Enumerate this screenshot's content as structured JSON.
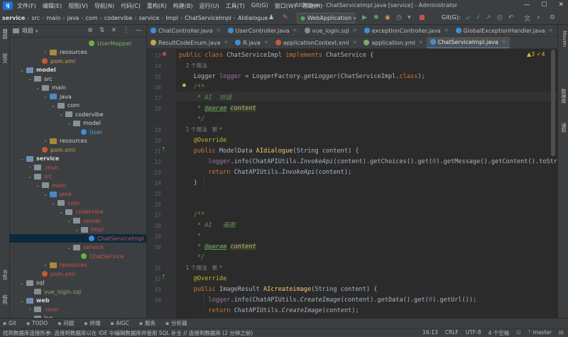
{
  "menubar": {
    "logo": "IJ",
    "items": [
      "文件(F)",
      "编辑(E)",
      "视图(V)",
      "导航(N)",
      "代码(C)",
      "重构(R)",
      "构建(B)",
      "运行(U)",
      "工具(T)",
      "Git(G)",
      "窗口(W)",
      "帮助(H)"
    ],
    "window_title": "AIGideon - ChatServiceImpl.java [service] - Administrator"
  },
  "navbar": {
    "breadcrumbs": [
      "service",
      "src",
      "main",
      "java",
      "com",
      "codervibe",
      "service",
      "Impl",
      "ChatServiceImpl",
      "AIdialogue"
    ],
    "run_config": "WebApplication",
    "git_label": "Git(G):"
  },
  "left_strip": {
    "labels": [
      "项目",
      "提交",
      "书签",
      "结构"
    ]
  },
  "right_strip": {
    "labels": [
      "Maven",
      "数据库",
      "通知"
    ]
  },
  "project_panel": {
    "title": "项目",
    "tree": [
      {
        "label": "UserMapper",
        "indent": 9,
        "arrow": "",
        "icon": "intf",
        "color": "tl-green"
      },
      {
        "label": "resources",
        "indent": 4,
        "arrow": "›",
        "icon": "res",
        "color": "tl-white"
      },
      {
        "label": "pom.xml",
        "indent": 3,
        "arrow": "",
        "icon": "pom",
        "color": "tl-orange"
      },
      {
        "label": "model",
        "indent": 1,
        "arrow": "⌄",
        "icon": "mod",
        "color": "tl-bold"
      },
      {
        "label": "src",
        "indent": 2,
        "arrow": "⌄",
        "icon": "folder",
        "color": "tl-white"
      },
      {
        "label": "main",
        "indent": 3,
        "arrow": "⌄",
        "icon": "folder",
        "color": "tl-white"
      },
      {
        "label": "java",
        "indent": 4,
        "arrow": "⌄",
        "icon": "blue",
        "color": "tl-white"
      },
      {
        "label": "com",
        "indent": 5,
        "arrow": "⌄",
        "icon": "folder",
        "color": "tl-white"
      },
      {
        "label": "codervibe",
        "indent": 6,
        "arrow": "⌄",
        "icon": "folder",
        "color": "tl-white"
      },
      {
        "label": "model",
        "indent": 7,
        "arrow": "⌄",
        "icon": "folder",
        "color": "tl-white"
      },
      {
        "label": "User",
        "indent": 8,
        "arrow": "",
        "icon": "cls",
        "color": "tl-blue"
      },
      {
        "label": "resources",
        "indent": 4,
        "arrow": "›",
        "icon": "res",
        "color": "tl-white"
      },
      {
        "label": "pom.xml",
        "indent": 3,
        "arrow": "",
        "icon": "pom",
        "color": "tl-orange"
      },
      {
        "label": "service",
        "indent": 1,
        "arrow": "⌄",
        "icon": "mod",
        "color": "tl-bold"
      },
      {
        "label": ".mvn",
        "indent": 2,
        "arrow": "›",
        "icon": "folder",
        "color": "tl-red"
      },
      {
        "label": "src",
        "indent": 2,
        "arrow": "⌄",
        "icon": "folder",
        "color": "tl-red"
      },
      {
        "label": "main",
        "indent": 3,
        "arrow": "⌄",
        "icon": "folder",
        "color": "tl-red"
      },
      {
        "label": "java",
        "indent": 4,
        "arrow": "⌄",
        "icon": "blue",
        "color": "tl-red"
      },
      {
        "label": "com",
        "indent": 5,
        "arrow": "⌄",
        "icon": "folder",
        "color": "tl-red"
      },
      {
        "label": "codervibe",
        "indent": 6,
        "arrow": "⌄",
        "icon": "folder",
        "color": "tl-red"
      },
      {
        "label": "server",
        "indent": 7,
        "arrow": "⌄",
        "icon": "folder",
        "color": "tl-red"
      },
      {
        "label": "Impl",
        "indent": 8,
        "arrow": "⌄",
        "icon": "folder",
        "color": "tl-red"
      },
      {
        "label": "ChatServiceImpl",
        "indent": 9,
        "arrow": "",
        "icon": "cls",
        "color": "tl-red",
        "selected": true
      },
      {
        "label": "service",
        "indent": 7,
        "arrow": "⌄",
        "icon": "folder",
        "color": "tl-red"
      },
      {
        "label": "ChatService",
        "indent": 8,
        "arrow": "",
        "icon": "intf",
        "color": "tl-red"
      },
      {
        "label": "resources",
        "indent": 4,
        "arrow": "›",
        "icon": "res",
        "color": "tl-red"
      },
      {
        "label": "pom.xml",
        "indent": 3,
        "arrow": "",
        "icon": "pom",
        "color": "tl-red"
      },
      {
        "label": "sql",
        "indent": 1,
        "arrow": "⌄",
        "icon": "folder",
        "color": "tl-white"
      },
      {
        "label": "vue_login.sql",
        "indent": 2,
        "arrow": "",
        "icon": "sql",
        "color": "tl-olive"
      },
      {
        "label": "web",
        "indent": 1,
        "arrow": "⌄",
        "icon": "mod",
        "color": "tl-bold"
      },
      {
        "label": ".mvn",
        "indent": 2,
        "arrow": "›",
        "icon": "folder",
        "color": "tl-red"
      },
      {
        "label": "log",
        "indent": 2,
        "arrow": "›",
        "icon": "folder",
        "color": "tl-white"
      }
    ]
  },
  "tabs_row1": [
    {
      "label": "ChatController.java",
      "color": "#3f8fd6",
      "active": false
    },
    {
      "label": "UserController.java",
      "color": "#3f8fd6",
      "active": false
    },
    {
      "label": "vue_login.sql",
      "color": "#8a8a8a",
      "active": false
    },
    {
      "label": "exceptionController.java",
      "color": "#3f8fd6",
      "active": false
    },
    {
      "label": "GlobalExceptionHandler.java",
      "color": "#3f8fd6",
      "active": false
    }
  ],
  "tabs_row2": [
    {
      "label": "ResultCodeEnum.java",
      "color": "#c9a24c",
      "active": false
    },
    {
      "label": "R.java",
      "color": "#3f8fd6",
      "active": false
    },
    {
      "label": "applicationContext.xml",
      "color": "#c45a3a",
      "active": false
    },
    {
      "label": "application.yml",
      "color": "#7fae5a",
      "active": false
    },
    {
      "label": "ChatServiceImpl.java",
      "color": "#3f8fd6",
      "active": true
    }
  ],
  "editor": {
    "inspection": "▲3  ✓4",
    "line_numbers": [
      "13",
      "14",
      "15",
      "16",
      "17",
      "18",
      "",
      "19",
      "20",
      "21",
      "22",
      "23",
      "24",
      "25",
      "26",
      "27",
      "28",
      "29",
      "30",
      "",
      "31",
      "32",
      "33",
      "34"
    ],
    "lines": [
      [
        {
          "t": "public class ",
          "c": "kw"
        },
        {
          "t": "ChatServiceImpl ",
          "c": ""
        },
        {
          "t": "implements ",
          "c": "kw"
        },
        {
          "t": "ChatService {",
          "c": ""
        }
      ],
      [
        {
          "t": "    2 个用法",
          "c": "hint"
        }
      ],
      [
        {
          "t": "    Logger ",
          "c": ""
        },
        {
          "t": "logger",
          "c": "fld"
        },
        {
          "t": " = LoggerFactory.",
          "c": ""
        },
        {
          "t": "getLogger",
          "c": "stat"
        },
        {
          "t": "(ChatServiceImpl.",
          "c": ""
        },
        {
          "t": "class",
          "c": "kw"
        },
        {
          "t": ");",
          "c": ""
        }
      ],
      [
        {
          "t": "    /**",
          "c": "cmt"
        }
      ],
      [
        {
          "t": "     * AI  对话",
          "c": "cmt"
        }
      ],
      [
        {
          "t": "     * ",
          "c": "cmt"
        },
        {
          "t": "@param",
          "c": "tag"
        },
        {
          "t": " ",
          "c": "cmt"
        },
        {
          "t": "content",
          "c": "pv"
        }
      ],
      [
        {
          "t": "     */",
          "c": "cmt"
        }
      ],
      [
        {
          "t": "    1 个用法   新 *",
          "c": "hint"
        }
      ],
      [
        {
          "t": "    ",
          "c": ""
        },
        {
          "t": "@Override",
          "c": "ann"
        }
      ],
      [
        {
          "t": "    ",
          "c": ""
        },
        {
          "t": "public ",
          "c": "kw"
        },
        {
          "t": "ModelData ",
          "c": ""
        },
        {
          "t": "AIdialogue",
          "c": "fn"
        },
        {
          "t": "(String content) {",
          "c": ""
        }
      ],
      [
        {
          "t": "        ",
          "c": ""
        },
        {
          "t": "logger",
          "c": "fld"
        },
        {
          "t": ".info(ChatAPIUtils.",
          "c": ""
        },
        {
          "t": "InvokeApi",
          "c": "stat"
        },
        {
          "t": "(content).getChoices().get(",
          "c": ""
        },
        {
          "t": "0",
          "c": "fld"
        },
        {
          "t": ").getMessage().getContent().toString());",
          "c": ""
        }
      ],
      [
        {
          "t": "        ",
          "c": ""
        },
        {
          "t": "return ",
          "c": "kw"
        },
        {
          "t": "ChatAPIUtils.",
          "c": ""
        },
        {
          "t": "InvokeApi",
          "c": "stat"
        },
        {
          "t": "(content);",
          "c": ""
        }
      ],
      [
        {
          "t": "    }",
          "c": ""
        }
      ],
      [
        {
          "t": "",
          "c": ""
        }
      ],
      [
        {
          "t": "",
          "c": ""
        }
      ],
      [
        {
          "t": "    /**",
          "c": "cmt"
        }
      ],
      [
        {
          "t": "     * AI   画图",
          "c": "cmt"
        }
      ],
      [
        {
          "t": "     *",
          "c": "cmt"
        }
      ],
      [
        {
          "t": "     * ",
          "c": "cmt"
        },
        {
          "t": "@param",
          "c": "tag"
        },
        {
          "t": " ",
          "c": "cmt"
        },
        {
          "t": "content",
          "c": "pv"
        }
      ],
      [
        {
          "t": "     */",
          "c": "cmt"
        }
      ],
      [
        {
          "t": "    1 个用法   新 *",
          "c": "hint"
        }
      ],
      [
        {
          "t": "    ",
          "c": ""
        },
        {
          "t": "@Override",
          "c": "ann"
        }
      ],
      [
        {
          "t": "    ",
          "c": ""
        },
        {
          "t": "public ",
          "c": "kw"
        },
        {
          "t": "ImageResult ",
          "c": ""
        },
        {
          "t": "AIcreateimage",
          "c": "fn"
        },
        {
          "t": "(String content) {",
          "c": ""
        }
      ],
      [
        {
          "t": "        ",
          "c": ""
        },
        {
          "t": "logger",
          "c": "fld"
        },
        {
          "t": ".info(ChatAPIUtils.",
          "c": ""
        },
        {
          "t": "CreateImage",
          "c": "stat"
        },
        {
          "t": "(content).getData().get(",
          "c": ""
        },
        {
          "t": "0",
          "c": "fld"
        },
        {
          "t": ").getUrl());",
          "c": ""
        }
      ],
      [
        {
          "t": "        ",
          "c": ""
        },
        {
          "t": "return ",
          "c": "kw"
        },
        {
          "t": "ChatAPIUtils.",
          "c": ""
        },
        {
          "t": "CreateImage",
          "c": "stat"
        },
        {
          "t": "(content);",
          "c": ""
        }
      ],
      [
        {
          "t": "    }",
          "c": ""
        }
      ]
    ]
  },
  "bottombar": {
    "items": [
      {
        "label": "Git",
        "icon": "git-icon"
      },
      {
        "label": "TODO",
        "icon": "todo-icon"
      },
      {
        "label": "问题",
        "icon": "problems-icon"
      },
      {
        "label": "终端",
        "icon": "terminal-icon"
      },
      {
        "label": "AIGC",
        "icon": "aigc-icon"
      },
      {
        "label": "服务",
        "icon": "services-icon"
      },
      {
        "label": "分析器",
        "icon": "profiler-icon"
      }
    ]
  },
  "statusbar": {
    "message": "找到数据库连接形参: 连接到数据库以在 IDE 中编辑数据库并使用 SQL 补全 // 连接到数据库 (2 分钟之前)",
    "position": "16:13",
    "line_sep": "CRLF",
    "encoding": "UTF-8",
    "indent": "4 个空格",
    "branch": "master"
  }
}
